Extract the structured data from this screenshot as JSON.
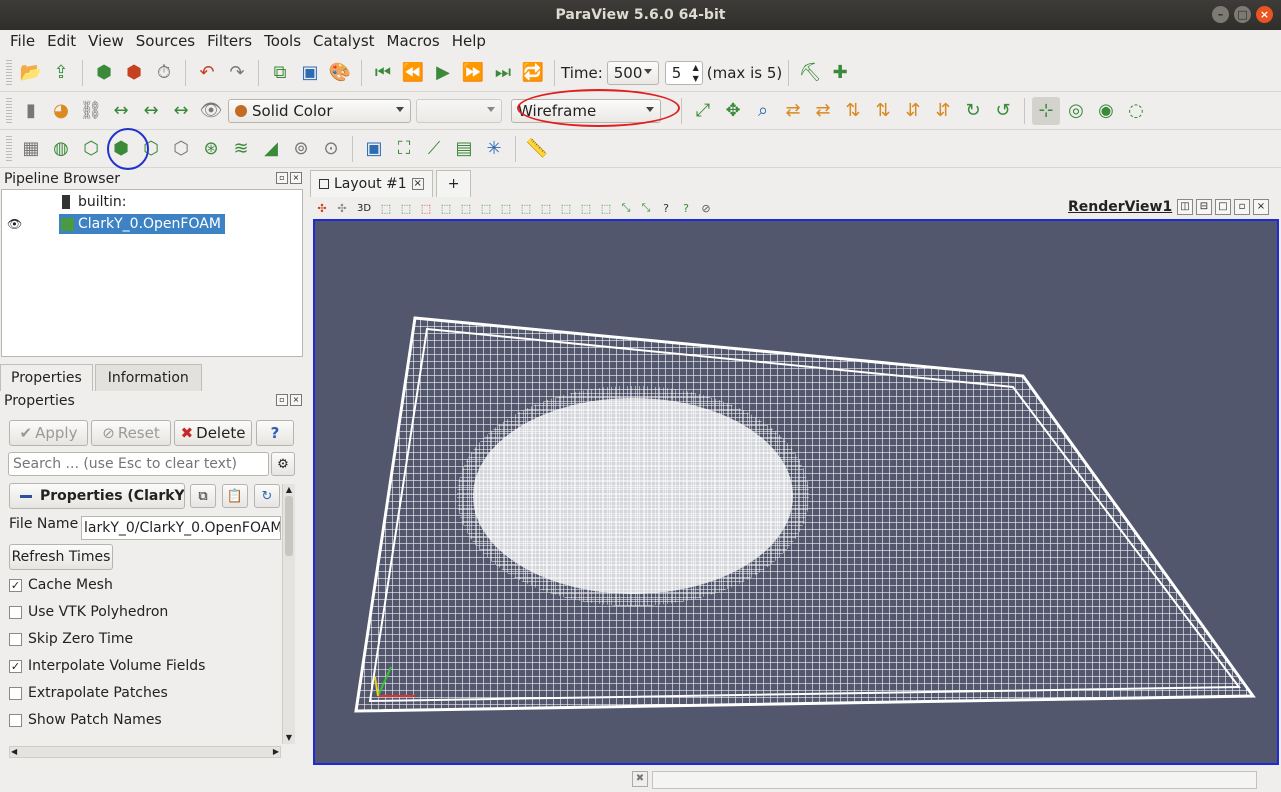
{
  "window": {
    "title": "ParaView 5.6.0 64-bit"
  },
  "menu": [
    "File",
    "Edit",
    "View",
    "Sources",
    "Filters",
    "Tools",
    "Catalyst",
    "Macros",
    "Help"
  ],
  "time": {
    "label": "Time:",
    "value": "500",
    "step": "5",
    "max_label": "(max is 5)"
  },
  "coloring": {
    "value": "Solid Color",
    "component": ""
  },
  "representation": {
    "value": "Wireframe"
  },
  "pipeline": {
    "title": "Pipeline Browser",
    "items": [
      {
        "label": "builtin:"
      },
      {
        "label": "ClarkY_0.OpenFOAM"
      }
    ]
  },
  "properties": {
    "tabs": [
      "Properties",
      "Information"
    ],
    "title": "Properties",
    "apply": "Apply",
    "reset": "Reset",
    "delete": "Delete",
    "help": "?",
    "search_placeholder": "Search ... (use Esc to clear text)",
    "section": "Properties (ClarkY_",
    "file_name_label": "File Name",
    "file_name_value": "larkY_0/ClarkY_0.OpenFOAM",
    "refresh": "Refresh Times",
    "checks": [
      {
        "label": "Cache Mesh",
        "checked": true
      },
      {
        "label": "Use VTK Polyhedron",
        "checked": false
      },
      {
        "label": "Skip Zero Time",
        "checked": false
      },
      {
        "label": "Interpolate Volume Fields",
        "checked": true
      },
      {
        "label": "Extrapolate Patches",
        "checked": false
      },
      {
        "label": "Show Patch Names",
        "checked": false
      }
    ]
  },
  "layout": {
    "tab": "Layout #1",
    "add": "+",
    "view_name": "RenderView1",
    "mode_3d": "3D"
  },
  "colors": {
    "render_bg": "#52576e",
    "selection": "#3d82c4",
    "annotation_red": "#e02020",
    "annotation_blue": "#2233cc"
  }
}
